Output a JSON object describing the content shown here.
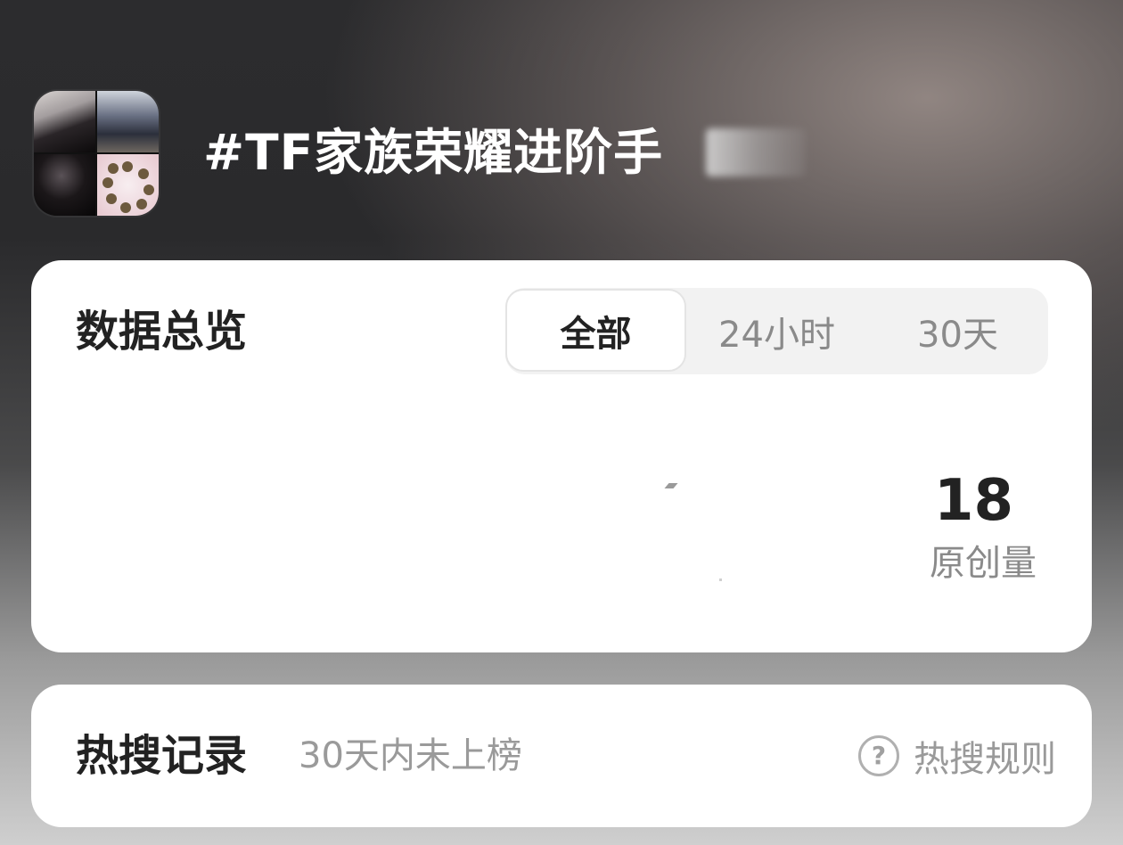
{
  "header": {
    "topic_title": "#TF家族荣耀进阶手"
  },
  "overview": {
    "title": "数据总览",
    "tabs": [
      {
        "label": "全部",
        "active": true
      },
      {
        "label": "24小时",
        "active": false
      },
      {
        "label": "30天",
        "active": false
      }
    ],
    "stat": {
      "value": "18",
      "label": "原创量"
    }
  },
  "hot_search": {
    "title": "热搜记录",
    "subtitle": "30天内未上榜",
    "rules_label": "热搜规则",
    "help_icon_glyph": "?"
  },
  "colors": {
    "card_bg": "#ffffff",
    "primary_text": "#222222",
    "secondary_text": "#8a8a8a",
    "segment_bg": "#f2f2f2"
  }
}
